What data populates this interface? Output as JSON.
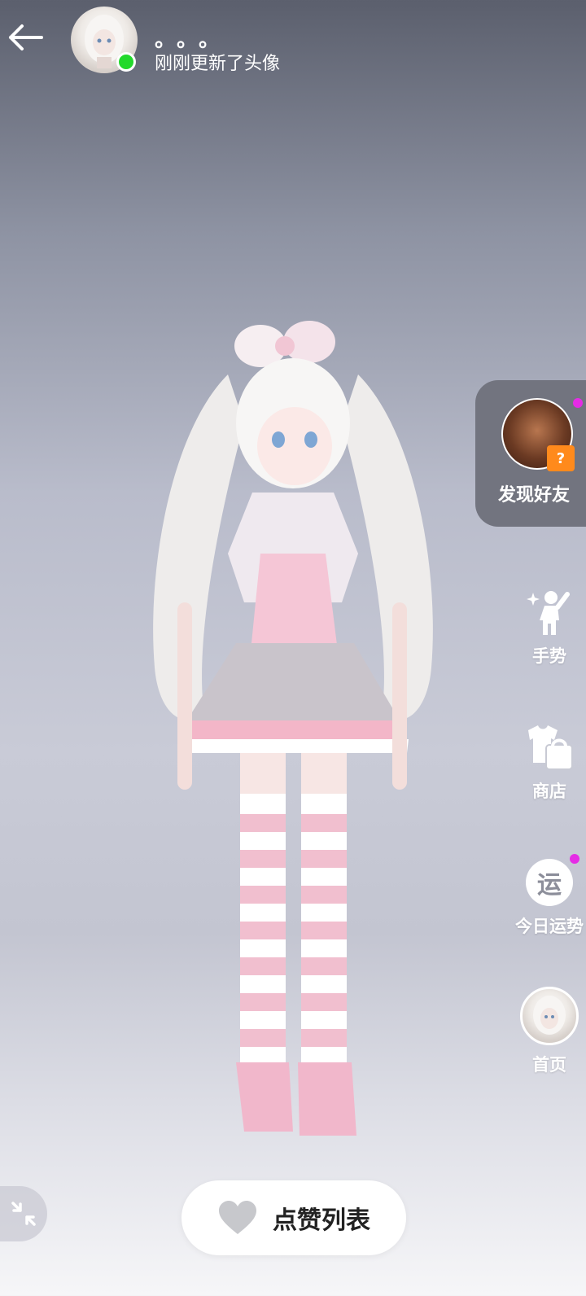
{
  "header": {
    "user_name": "。。。",
    "status_text": "刚刚更新了头像",
    "online_color": "#22d92b"
  },
  "side_panel": {
    "discover": {
      "label": "发现好友",
      "badge_glyph": "?",
      "has_notification": true
    },
    "items": [
      {
        "icon": "gesture-icon",
        "label": "手势"
      },
      {
        "icon": "shop-icon",
        "label": "商店"
      },
      {
        "icon": "fortune-icon",
        "glyph": "运",
        "label": "今日运势",
        "has_notification": true
      },
      {
        "icon": "home-avatar",
        "label": "首页"
      }
    ]
  },
  "bottom": {
    "likes_label": "点赞列表"
  },
  "colors": {
    "notification_dot": "#e52ce5",
    "card_bg": "#72747f"
  }
}
